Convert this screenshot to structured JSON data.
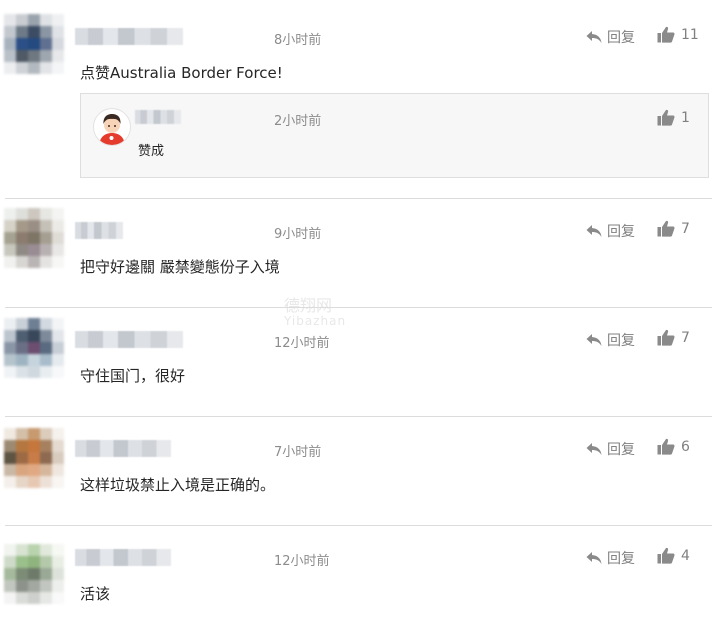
{
  "comments": [
    {
      "time": "8小时前",
      "text": "点赞Australia Border Force!",
      "reply_label": "回复",
      "likes": "11",
      "reply": {
        "time": "2小时前",
        "text": "赞成",
        "likes": "1"
      }
    },
    {
      "time": "9小时前",
      "text": "把守好邊關 嚴禁變態份子入境",
      "reply_label": "回复",
      "likes": "7"
    },
    {
      "time": "12小时前",
      "text": "守住国门，很好",
      "reply_label": "回复",
      "likes": "7"
    },
    {
      "time": "7小时前",
      "text": "这样垃圾禁止入境是正确的。",
      "reply_label": "回复",
      "likes": "6"
    },
    {
      "time": "12小时前",
      "text": "活该",
      "reply_label": "回复",
      "likes": "4"
    }
  ],
  "watermark": {
    "line1": "德翔网",
    "line2": "Yibazhan"
  },
  "icons": {
    "reply": "reply-arrow-icon",
    "like": "thumbs-up-icon"
  }
}
